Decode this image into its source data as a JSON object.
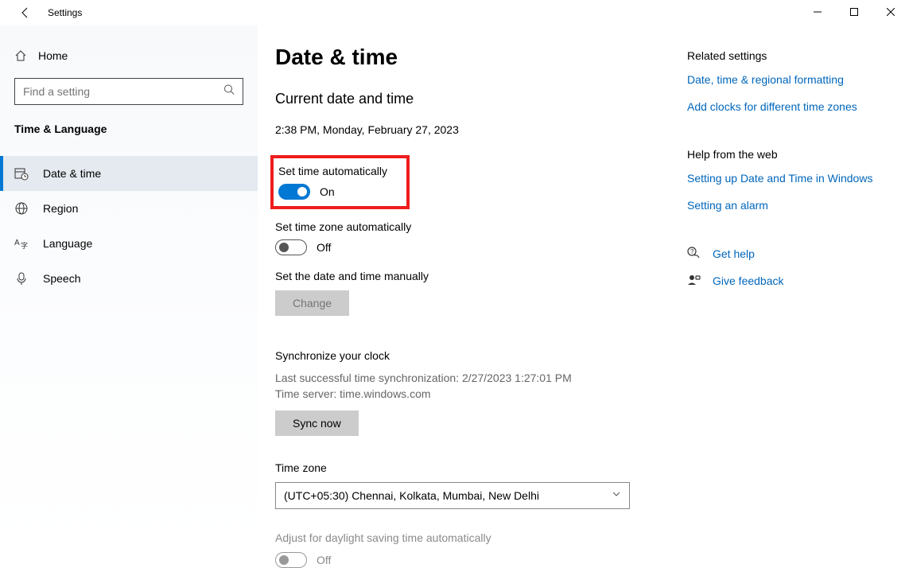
{
  "titlebar": {
    "app_title": "Settings"
  },
  "sidebar": {
    "home_label": "Home",
    "search_placeholder": "Find a setting",
    "category_title": "Time & Language",
    "items": [
      {
        "label": "Date & time"
      },
      {
        "label": "Region"
      },
      {
        "label": "Language"
      },
      {
        "label": "Speech"
      }
    ]
  },
  "page": {
    "title": "Date & time",
    "current_section": "Current date and time",
    "current_datetime": "2:38 PM, Monday, February 27, 2023",
    "settings": {
      "auto_time": {
        "label": "Set time automatically",
        "state": "On"
      },
      "auto_tz": {
        "label": "Set time zone automatically",
        "state": "Off"
      },
      "manual_label": "Set the date and time manually",
      "change_btn": "Change",
      "dst_label": "Adjust for daylight saving time automatically",
      "dst_state": "Off"
    },
    "sync": {
      "heading": "Synchronize your clock",
      "last_sync": "Last successful time synchronization: 2/27/2023 1:27:01 PM",
      "server": "Time server: time.windows.com",
      "btn": "Sync now"
    },
    "tz": {
      "heading": "Time zone",
      "selected": "(UTC+05:30) Chennai, Kolkata, Mumbai, New Delhi"
    }
  },
  "side": {
    "related_head": "Related settings",
    "related_links": [
      "Date, time & regional formatting",
      "Add clocks for different time zones"
    ],
    "help_head": "Help from the web",
    "help_links": [
      "Setting up Date and Time in Windows",
      "Setting an alarm"
    ],
    "get_help": "Get help",
    "give_feedback": "Give feedback"
  }
}
